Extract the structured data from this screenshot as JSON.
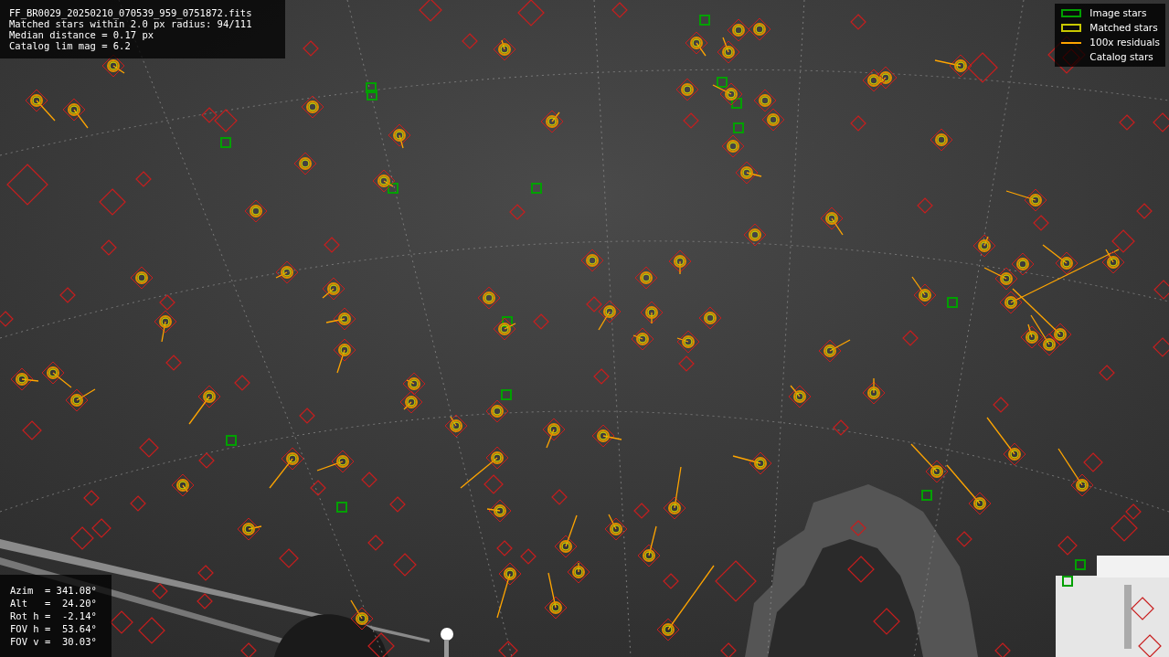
{
  "info": {
    "lines": [
      "FF_BR0029_20250210_070539_959_0751872.fits",
      "Matched stars within 2.0 px radius: 94/111",
      "Median distance = 0.17 px",
      "Catalog lim mag = 6.2"
    ]
  },
  "legend": [
    {
      "label": "Image stars",
      "color": "#00a000"
    },
    {
      "kind": "matched",
      "label": "Matched stars",
      "color": "#c8c800"
    },
    {
      "kind": "residual",
      "label": "100x residuals",
      "color": "#ffa500"
    },
    {
      "kind": "catalog",
      "label": "Catalog stars",
      "color": "#3a0000"
    }
  ],
  "pointing": {
    "lines": [
      "Azim  = 341.08°",
      "Alt   =  24.20°",
      "Rot h =  -2.14°",
      "FOV h =  53.64°",
      "FOV v =  30.03°"
    ]
  }
}
